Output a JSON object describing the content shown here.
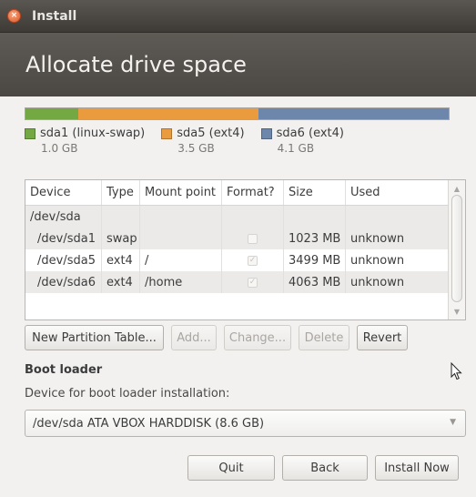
{
  "window": {
    "title": "Install",
    "close_glyph": "×"
  },
  "header": {
    "title": "Allocate drive space"
  },
  "usage": {
    "segments": [
      {
        "label": "sda1 (linux-swap)",
        "size": "1.0 GB",
        "color": "#73a843",
        "fraction": 0.125
      },
      {
        "label": "sda5 (ext4)",
        "size": "3.5 GB",
        "color": "#ea9b3e",
        "fraction": 0.425
      },
      {
        "label": "sda6 (ext4)",
        "size": "4.1 GB",
        "color": "#6d86ab",
        "fraction": 0.45
      }
    ]
  },
  "table": {
    "columns": [
      "Device",
      "Type",
      "Mount point",
      "Format?",
      "Size",
      "Used"
    ],
    "rows": [
      {
        "device": "/dev/sda",
        "type": "",
        "mount": "",
        "format": "",
        "size": "",
        "used": ""
      },
      {
        "device": "/dev/sda1",
        "type": "swap",
        "mount": "",
        "format": "",
        "size": "1023 MB",
        "used": "unknown"
      },
      {
        "device": "/dev/sda5",
        "type": "ext4",
        "mount": "/",
        "format": "✓",
        "size": "3499 MB",
        "used": "unknown"
      },
      {
        "device": "/dev/sda6",
        "type": "ext4",
        "mount": "/home",
        "format": "✓",
        "size": "4063 MB",
        "used": "unknown"
      }
    ]
  },
  "buttons": {
    "new_partition_table": "New Partition Table...",
    "add": "Add...",
    "change": "Change...",
    "delete": "Delete",
    "revert": "Revert"
  },
  "bootloader": {
    "title": "Boot loader",
    "label": "Device for boot loader installation:",
    "selected": "/dev/sda ATA VBOX HARDDISK (8.6 GB)"
  },
  "footer": {
    "quit": "Quit",
    "back": "Back",
    "install_now": "Install Now"
  }
}
